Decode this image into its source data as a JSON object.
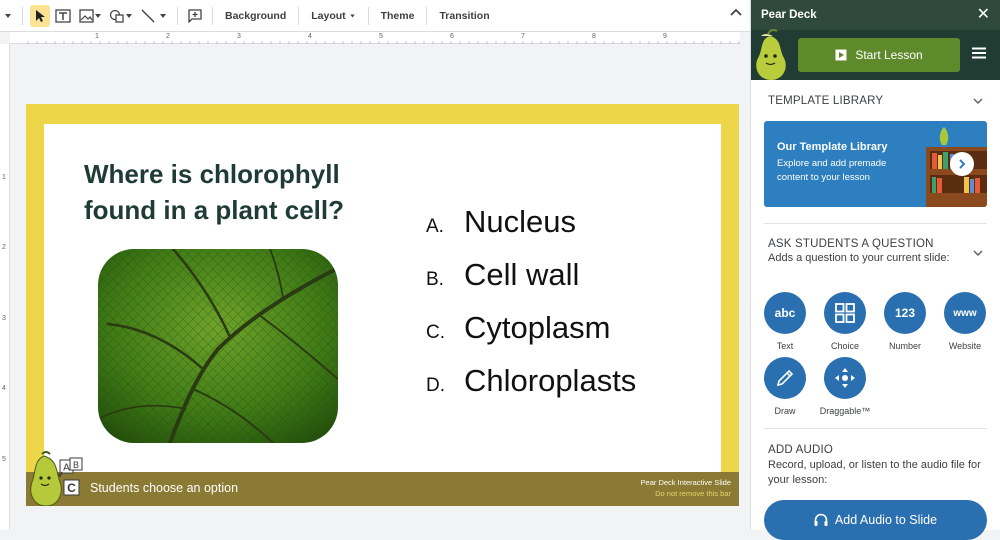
{
  "toolbar": {
    "background_label": "Background",
    "layout_label": "Layout",
    "theme_label": "Theme",
    "transition_label": "Transition"
  },
  "ruler": {
    "top_numbers": [
      "1",
      "2",
      "3",
      "4",
      "5",
      "6",
      "7",
      "8",
      "9"
    ],
    "left_numbers": [
      "1",
      "2",
      "3",
      "4",
      "5"
    ]
  },
  "slide": {
    "question": "Where is chlorophyll found in a plant cell?",
    "answers": [
      {
        "letter": "A.",
        "text": "Nucleus"
      },
      {
        "letter": "B.",
        "text": "Cell wall"
      },
      {
        "letter": "C.",
        "text": "Cytoplasm"
      },
      {
        "letter": "D.",
        "text": "Chloroplasts"
      }
    ],
    "bar_text": "Students choose an option",
    "bar_right_line1": "Pear Deck Interactive Slide",
    "bar_right_line2": "Do not remove this bar",
    "mascot_letters": [
      "A",
      "B",
      "C"
    ]
  },
  "sidebar": {
    "title": "Pear Deck",
    "start_label": "Start Lesson",
    "template_title": "TEMPLATE LIBRARY",
    "library_title": "Our Template Library",
    "library_sub": "Explore and add premade content to your lesson",
    "ask_title": "ASK STUDENTS A QUESTION",
    "ask_sub": "Adds a question to your current slide:",
    "question_types": [
      {
        "icon": "abc",
        "label": "Text"
      },
      {
        "icon": "",
        "label": "Choice"
      },
      {
        "icon": "123",
        "label": "Number"
      },
      {
        "icon": "www",
        "label": "Website"
      },
      {
        "icon": "",
        "label": "Draw"
      },
      {
        "icon": "",
        "label": "Draggable™"
      }
    ],
    "audio_title": "ADD AUDIO",
    "audio_sub": "Record, upload, or listen to the audio file for your lesson:",
    "audio_button": "Add Audio to Slide"
  },
  "colors": {
    "sidebar_header": "#2f4a3d",
    "start_button": "#5e8a2c",
    "accent_blue": "#2a6fb0",
    "slide_border": "#edd64a",
    "bottom_bar": "#8b7a33"
  }
}
